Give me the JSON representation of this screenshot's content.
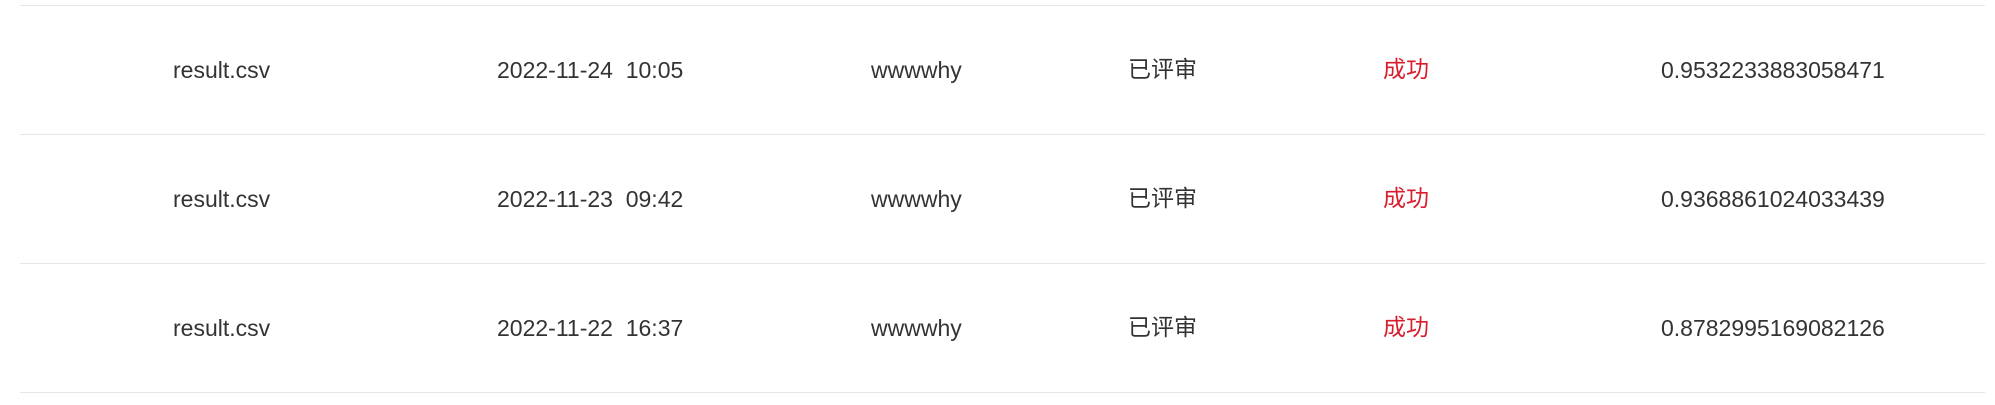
{
  "colors": {
    "text": "#333333",
    "success": "#d81e2c",
    "divider": "#e6e6e6"
  },
  "rows": [
    {
      "file": "result.csv",
      "time": "2022-11-24  10:05",
      "user": "wwwwhy",
      "review": "已评审",
      "status": "成功",
      "score": "0.9532233883058471"
    },
    {
      "file": "result.csv",
      "time": "2022-11-23  09:42",
      "user": "wwwwhy",
      "review": "已评审",
      "status": "成功",
      "score": "0.9368861024033439"
    },
    {
      "file": "result.csv",
      "time": "2022-11-22  16:37",
      "user": "wwwwhy",
      "review": "已评审",
      "status": "成功",
      "score": "0.8782995169082126"
    }
  ]
}
